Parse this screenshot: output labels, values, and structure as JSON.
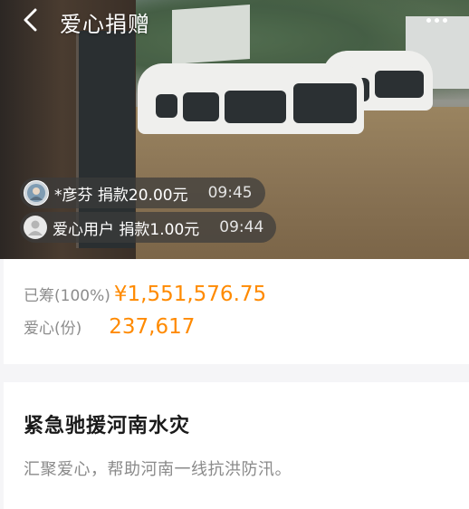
{
  "header": {
    "title": "爱心捐赠",
    "back_icon": "chevron-left-icon",
    "more_icon": "more-dots-icon"
  },
  "donations": [
    {
      "text": "*彦芬 捐款20.00元",
      "time": "09:45",
      "avatar": "user-photo-avatar"
    },
    {
      "text": "爱心用户 捐款1.00元",
      "time": "09:44",
      "avatar": "default-user-avatar"
    }
  ],
  "stats": {
    "raised_label": "已筹(100%)",
    "raised_value": "¥1,551,576.75",
    "shares_label": "爱心(份)",
    "shares_value": "237,617",
    "accent_color": "#ff8a00"
  },
  "project": {
    "title": "紧急驰援河南水灾",
    "description": "汇聚爱心，帮助河南一线抗洪防汛。"
  }
}
